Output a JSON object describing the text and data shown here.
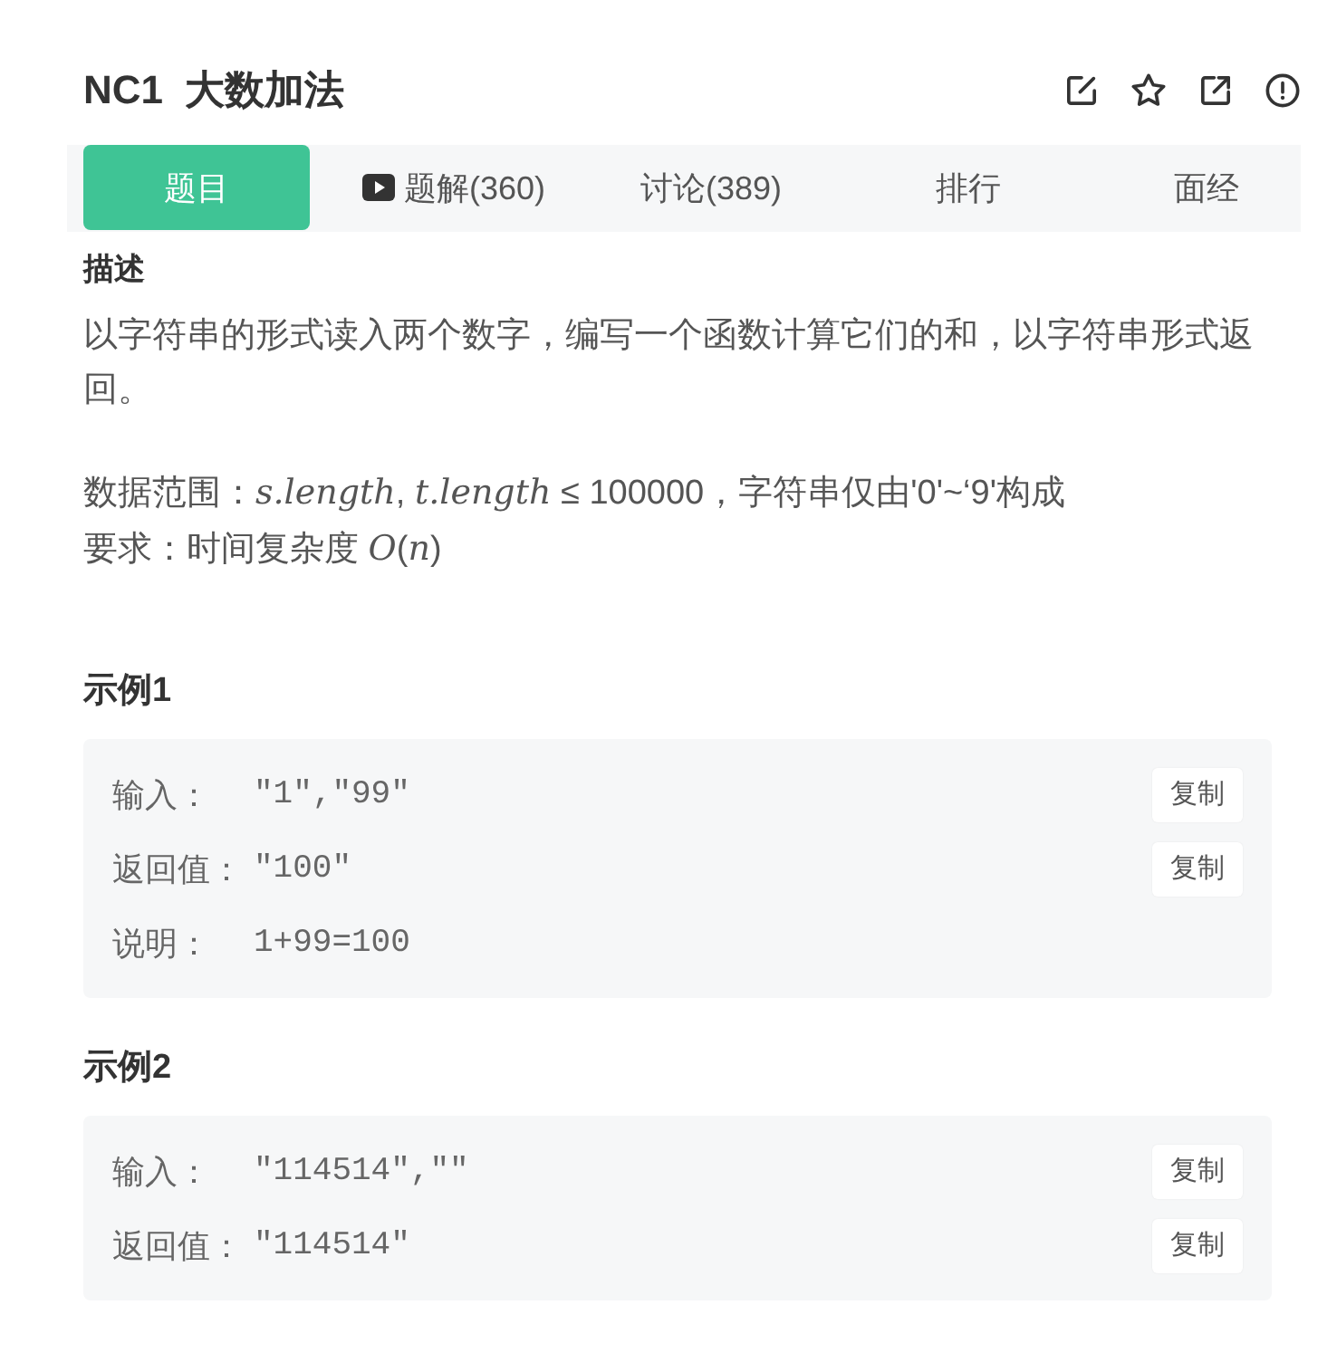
{
  "header": {
    "title": "NC1 大数加法"
  },
  "tabs": [
    {
      "label": "题目",
      "kind": "plain",
      "selected": true
    },
    {
      "label": "题解(360)",
      "kind": "video",
      "selected": false
    },
    {
      "label": "讨论(389)",
      "kind": "plain",
      "selected": false
    },
    {
      "label": "排行",
      "kind": "plain",
      "selected": false
    },
    {
      "label": "面经",
      "kind": "plain",
      "selected": false
    }
  ],
  "description": {
    "heading": "描述",
    "text": "以字符串的形式读入两个数字，编写一个函数计算它们的和，以字符串形式返回。",
    "constraints": [
      "数据范围：*s.length*, *t.length* ≤ 100000，字符串仅由'0'~‘9'构成",
      "要求：时间复杂度 *O*(*n*)"
    ]
  },
  "examples": [
    {
      "title": "示例1",
      "rows": [
        {
          "label": "输入：",
          "value": "\"1\",\"99\"",
          "copy_button": "复制"
        },
        {
          "label": "返回值：",
          "value": "\"100\"",
          "copy_button": "复制"
        },
        {
          "label": "说明：",
          "value": "1+99=100"
        }
      ]
    },
    {
      "title": "示例2",
      "rows": [
        {
          "label": "输入：",
          "value": "\"114514\",\"\"",
          "copy_button": "复制"
        },
        {
          "label": "返回值：",
          "value": "\"114514\"",
          "copy_button": "复制"
        }
      ]
    }
  ]
}
